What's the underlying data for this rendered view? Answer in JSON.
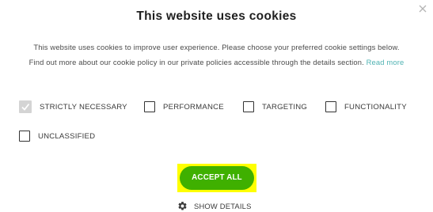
{
  "dialog": {
    "title": "This website uses cookies",
    "description_line1": "This website uses cookies to improve user experience. Please choose your preferred cookie settings below.",
    "description_line2": "Find out more about our cookie policy in our private policies accessible through the details section.",
    "read_more_label": "Read more",
    "close_icon": "close-icon"
  },
  "options": [
    {
      "label": "STRICTLY NECESSARY",
      "checked": true,
      "disabled": true
    },
    {
      "label": "PERFORMANCE",
      "checked": false
    },
    {
      "label": "TARGETING",
      "checked": false
    },
    {
      "label": "FUNCTIONALITY",
      "checked": false
    },
    {
      "label": "UNCLASSIFIED",
      "checked": false
    }
  ],
  "buttons": {
    "accept_all_label": "ACCEPT ALL",
    "show_details_label": "SHOW DETAILS",
    "show_details_icon": "gear-icon"
  },
  "colors": {
    "accent": "#3fb000",
    "link": "#4fb3b3",
    "highlight": "#ffff00"
  }
}
